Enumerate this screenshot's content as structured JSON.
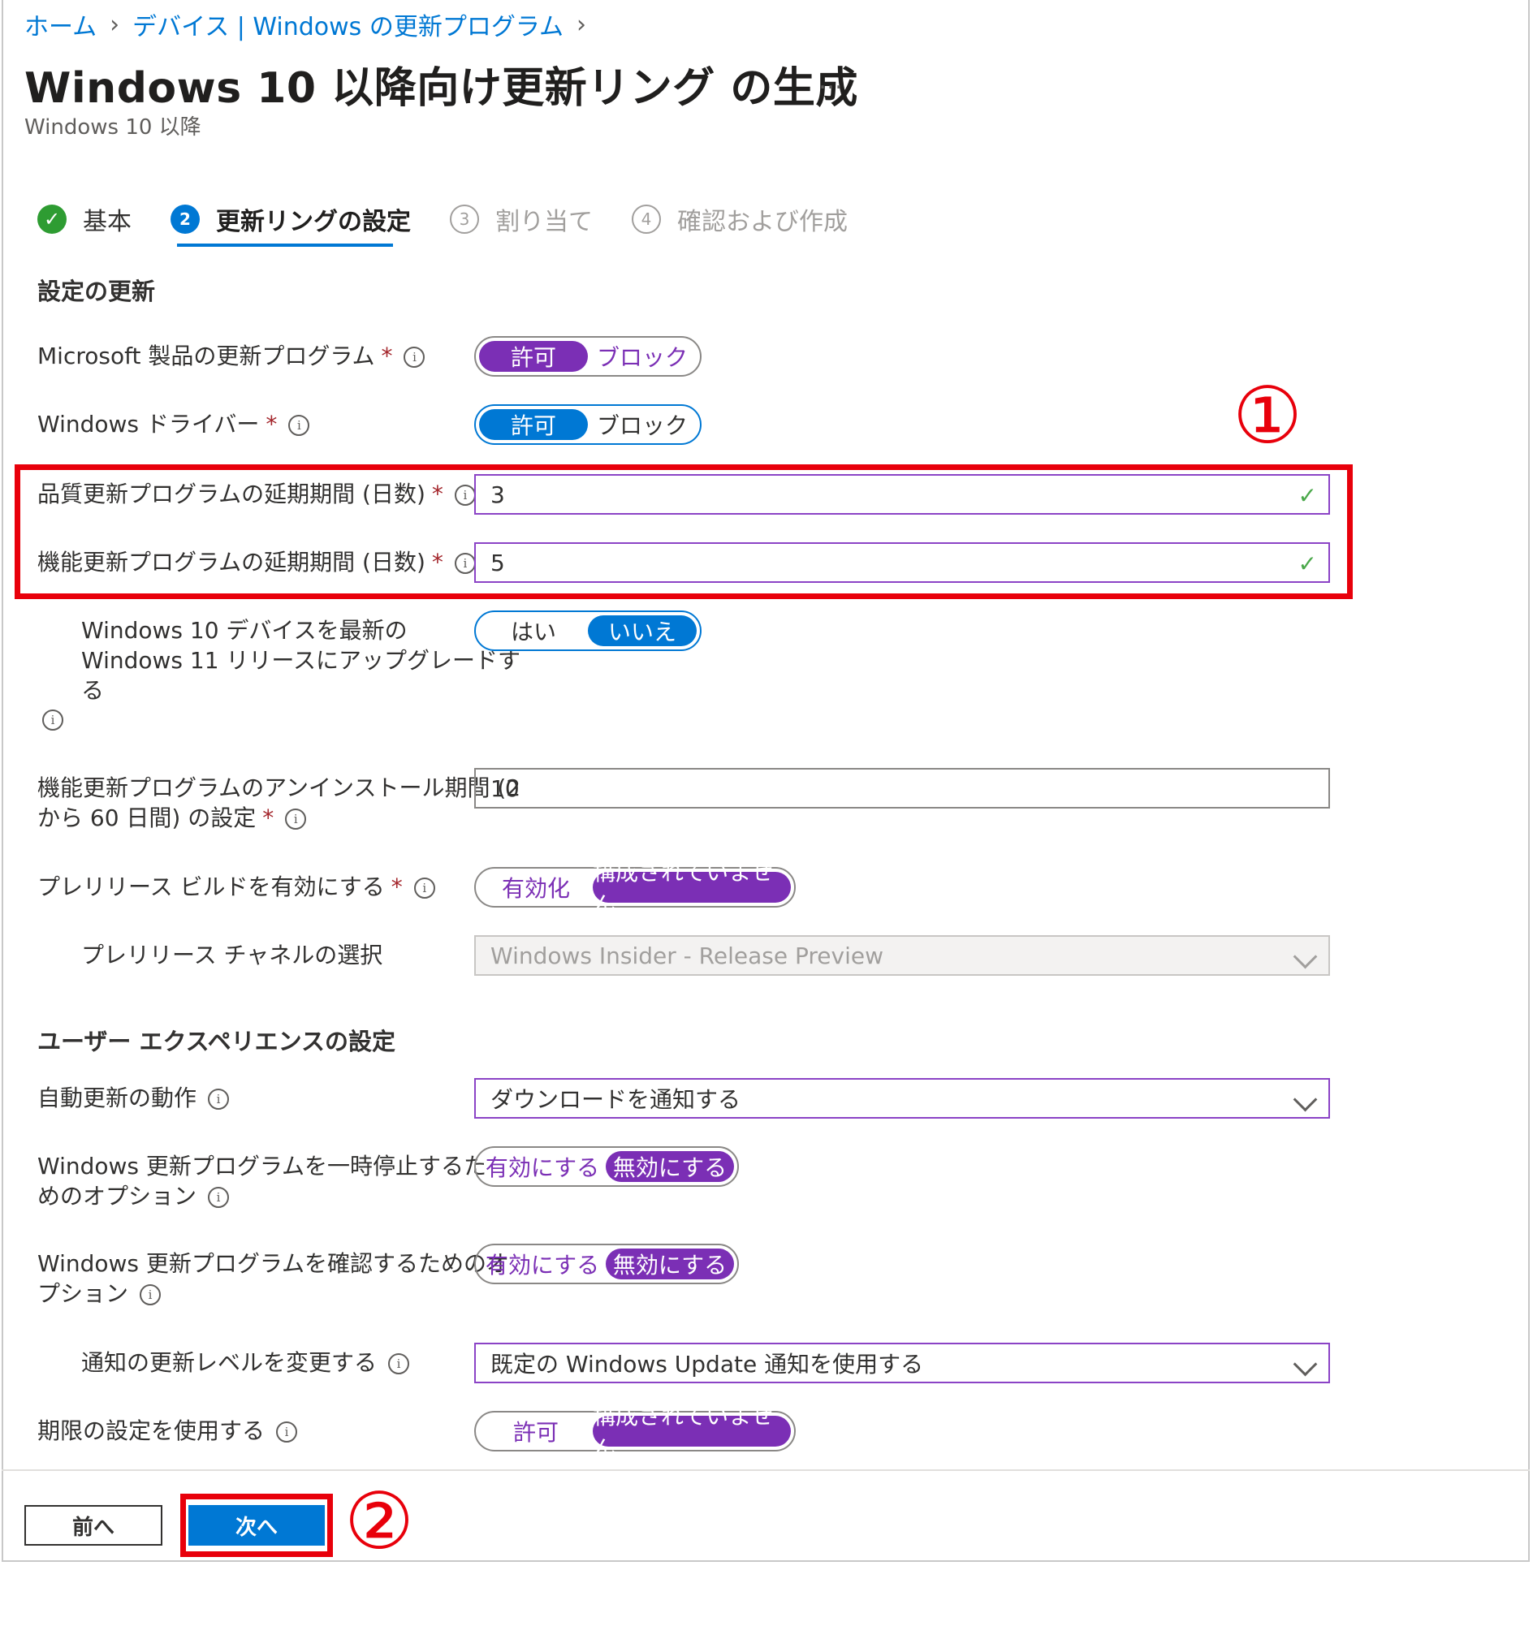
{
  "breadcrumb": {
    "home": "ホーム",
    "section": "デバイス | Windows の更新プログラム"
  },
  "title": "Windows 10 以降向け更新リング の生成",
  "more": "…",
  "subtitle": "Windows 10 以降",
  "steps": [
    {
      "label": "基本",
      "state": "done",
      "marker": "✓"
    },
    {
      "label": "更新リングの設定",
      "state": "active",
      "marker": "2"
    },
    {
      "label": "割り当て",
      "state": "pending",
      "marker": "3"
    },
    {
      "label": "確認および作成",
      "state": "pending",
      "marker": "4"
    }
  ],
  "section_update": "設定の更新",
  "rows": {
    "ms_products": {
      "label": "Microsoft 製品の更新プログラム",
      "opt_a": "許可",
      "opt_b": "ブロック",
      "selected": "許可"
    },
    "drivers": {
      "label": "Windows ドライバー",
      "opt_a": "許可",
      "opt_b": "ブロック",
      "selected": "許可"
    },
    "quality_deferral": {
      "label": "品質更新プログラムの延期期間 (日数)",
      "value": "3"
    },
    "feature_deferral": {
      "label": "機能更新プログラムの延期期間 (日数)",
      "value": "5"
    },
    "upgrade_win11": {
      "label_1": "Windows 10 デバイスを最新の",
      "label_2": "Windows 11 リリースにアップグレードす",
      "label_3": "る",
      "opt_a": "はい",
      "opt_b": "いいえ",
      "selected": "いいえ"
    },
    "uninstall_period": {
      "label_1": "機能更新プログラムのアンインストール期間 (2",
      "label_2": "から 60 日間) の設定",
      "value": "10"
    },
    "prerelease": {
      "label": "プレリリース ビルドを有効にする",
      "opt_a": "有効化",
      "opt_b": "構成されていません",
      "selected": "構成されていません"
    },
    "prerelease_channel": {
      "label": "プレリリース チャネルの選択",
      "value": "Windows Insider - Release Preview"
    }
  },
  "section_ux": "ユーザー エクスペリエンスの設定",
  "ux_rows": {
    "auto_update": {
      "label": "自動更新の動作",
      "value": "ダウンロードを通知する"
    },
    "pause_option": {
      "label_1": "Windows 更新プログラムを一時停止するた",
      "label_2": "めのオプション",
      "opt_a": "有効にする",
      "opt_b": "無効にする",
      "selected": "無効にする"
    },
    "check_option": {
      "label_1": "Windows 更新プログラムを確認するためのオ",
      "label_2": "プション",
      "opt_a": "有効にする",
      "opt_b": "無効にする",
      "selected": "無効にする"
    },
    "notification_level": {
      "label": "通知の更新レベルを変更する",
      "value": "既定の Windows Update 通知を使用する"
    },
    "deadline": {
      "label": "期限の設定を使用する",
      "opt_a": "許可",
      "opt_b": "構成されていません",
      "selected": "構成されていません"
    }
  },
  "required_mark": "*",
  "info_glyph": "i",
  "valid_glyph": "✓",
  "footer": {
    "prev": "前へ",
    "next": "次へ"
  },
  "annotations": {
    "one": "①",
    "two": "②"
  },
  "colors": {
    "accent_blue": "#0078d4",
    "toggle_purple": "#7b2fb5",
    "annotation_red": "#e8000b",
    "valid_green": "#4aa84a"
  }
}
